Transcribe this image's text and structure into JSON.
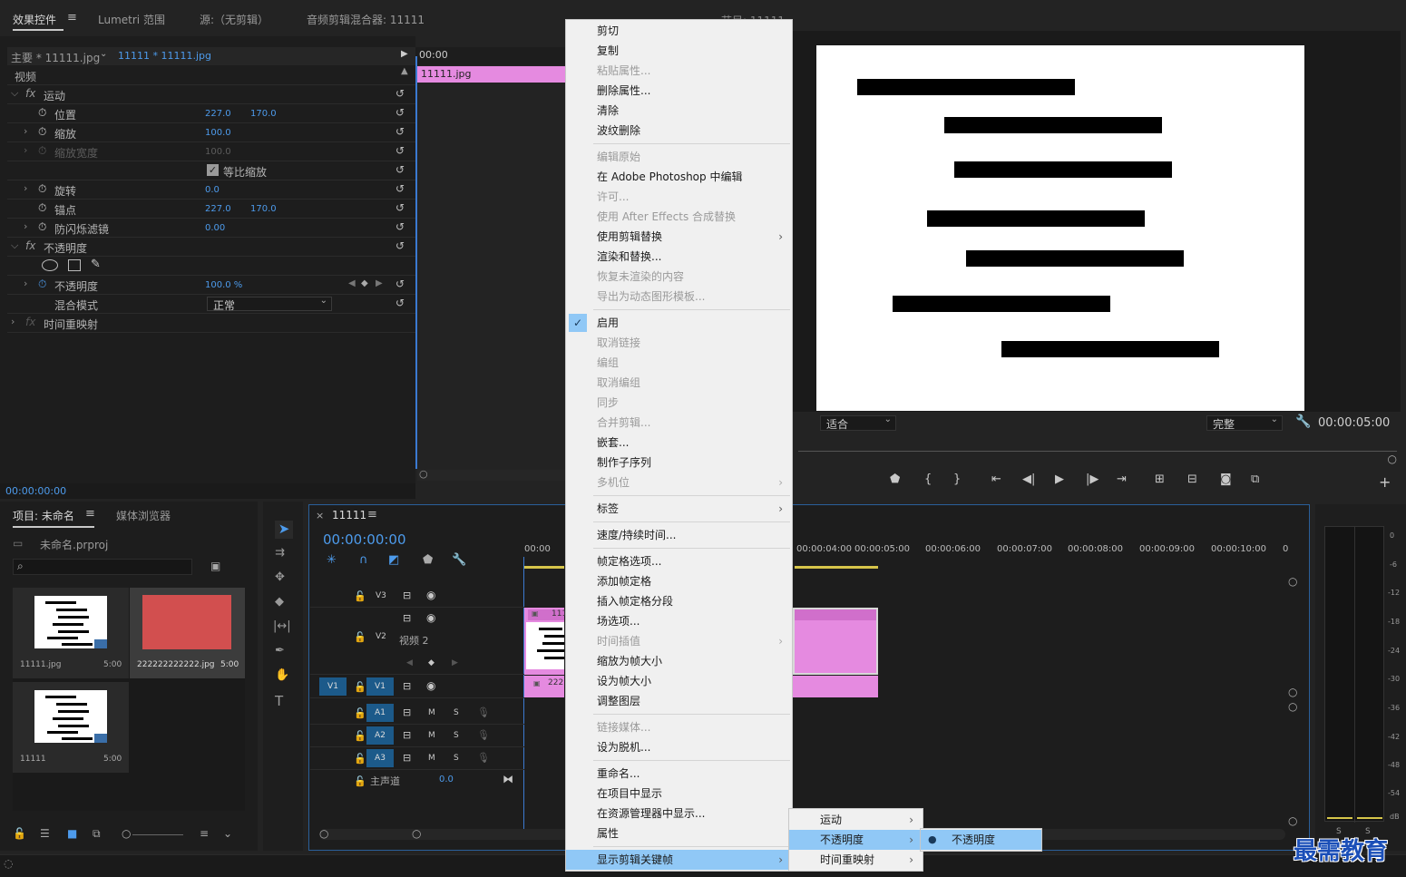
{
  "effects_panel": {
    "tabs": [
      "效果控件",
      "Lumetri 范围",
      "源:（无剪辑）",
      "音频剪辑混合器: 11111"
    ],
    "source_label": "主要 * 11111.jpg",
    "sequence_label": "11111 * 11111.jpg",
    "timecode_mini": "00:00",
    "clip_name": "11111.jpg",
    "section_video": "视频",
    "rows": {
      "motion": "运动",
      "position": "位置",
      "position_x": "227.0",
      "position_y": "170.0",
      "scale": "缩放",
      "scale_v": "100.0",
      "scale_width": "缩放宽度",
      "scale_width_v": "100.0",
      "uniform_scale": "等比缩放",
      "rotation": "旋转",
      "rotation_v": "0.0",
      "anchor": "锚点",
      "anchor_x": "227.0",
      "anchor_y": "170.0",
      "antiflicker": "防闪烁滤镜",
      "antiflicker_v": "0.00",
      "opacity_group": "不透明度",
      "opacity": "不透明度",
      "opacity_v": "100.0 %",
      "blend": "混合模式",
      "blend_v": "正常",
      "time_remap": "时间重映射"
    },
    "bottom_timecode": "00:00:00:00"
  },
  "program_monitor": {
    "title": "节目: 11111",
    "fit": "适合",
    "quality": "完整",
    "timecode": "00:00:05:00"
  },
  "context_menu": {
    "items": [
      {
        "label": "剪切",
        "enabled": true
      },
      {
        "label": "复制",
        "enabled": true
      },
      {
        "label": "粘贴属性...",
        "enabled": false
      },
      {
        "label": "删除属性...",
        "enabled": true
      },
      {
        "label": "清除",
        "enabled": true
      },
      {
        "label": "波纹删除",
        "enabled": true
      },
      {
        "label": "编辑原始",
        "enabled": false
      },
      {
        "label": "在 Adobe Photoshop 中编辑",
        "enabled": true
      },
      {
        "label": "许可...",
        "enabled": false
      },
      {
        "label": "使用 After Effects 合成替换",
        "enabled": false
      },
      {
        "label": "使用剪辑替换",
        "enabled": true
      },
      {
        "label": "渲染和替换...",
        "enabled": true
      },
      {
        "label": "恢复未渲染的内容",
        "enabled": false
      },
      {
        "label": "导出为动态图形模板...",
        "enabled": false
      },
      {
        "label": "启用",
        "enabled": true
      },
      {
        "label": "取消链接",
        "enabled": false
      },
      {
        "label": "编组",
        "enabled": false
      },
      {
        "label": "取消编组",
        "enabled": false
      },
      {
        "label": "同步",
        "enabled": false
      },
      {
        "label": "合并剪辑...",
        "enabled": false
      },
      {
        "label": "嵌套...",
        "enabled": true
      },
      {
        "label": "制作子序列",
        "enabled": true
      },
      {
        "label": "多机位",
        "enabled": false
      },
      {
        "label": "标签",
        "enabled": true
      },
      {
        "label": "速度/持续时间...",
        "enabled": true
      },
      {
        "label": "帧定格选项...",
        "enabled": true
      },
      {
        "label": "添加帧定格",
        "enabled": true
      },
      {
        "label": "插入帧定格分段",
        "enabled": true
      },
      {
        "label": "场选项...",
        "enabled": true
      },
      {
        "label": "时间插值",
        "enabled": false
      },
      {
        "label": "缩放为帧大小",
        "enabled": true
      },
      {
        "label": "设为帧大小",
        "enabled": true
      },
      {
        "label": "调整图层",
        "enabled": true
      },
      {
        "label": "链接媒体...",
        "enabled": false
      },
      {
        "label": "设为脱机...",
        "enabled": true
      },
      {
        "label": "重命名...",
        "enabled": true
      },
      {
        "label": "在项目中显示",
        "enabled": true
      },
      {
        "label": "在资源管理器中显示...",
        "enabled": true
      },
      {
        "label": "属性",
        "enabled": true
      },
      {
        "label": "显示剪辑关键帧",
        "enabled": true
      }
    ],
    "submenu": [
      "运动",
      "不透明度",
      "时间重映射"
    ],
    "submenu2": [
      "不透明度"
    ]
  },
  "project_panel": {
    "tabs": [
      "项目: 未命名",
      "媒体浏览器"
    ],
    "project_file": "未命名.prproj",
    "items": [
      {
        "name": "11111.jpg",
        "duration": "5:00"
      },
      {
        "name": "222222222222.jpg",
        "duration": "5:00"
      },
      {
        "name": "11111",
        "duration": "5:00"
      }
    ]
  },
  "timeline": {
    "sequence": "11111",
    "timecode": "00:00:00:00",
    "ruler": [
      "00:00",
      "00:00:04:00",
      "00:00:05:00",
      "00:00:06:00",
      "00:00:07:00",
      "00:00:08:00",
      "00:00:09:00",
      "00:00:10:00",
      "0"
    ],
    "tracks": {
      "v3": "V3",
      "v2": "V2",
      "v2_name": "视频 2",
      "v1": "V1",
      "v1_src": "V1",
      "a1": "A1",
      "a2": "A2",
      "a3": "A3",
      "m": "M",
      "s": "S",
      "master": "主声道",
      "master_v": "0.0"
    },
    "clip_v2": "111",
    "clip_v1": "222"
  },
  "meter": {
    "scale": [
      "0",
      "-6",
      "-12",
      "-18",
      "-24",
      "-30",
      "-36",
      "-42",
      "-48",
      "-54",
      "dB"
    ],
    "ss": [
      "S",
      "S"
    ]
  },
  "watermark": "最需教育",
  "colors": {
    "accent_blue": "#4d9bec",
    "clip_pink": "#e58ae0",
    "menu_highlight": "#90c8f6"
  }
}
